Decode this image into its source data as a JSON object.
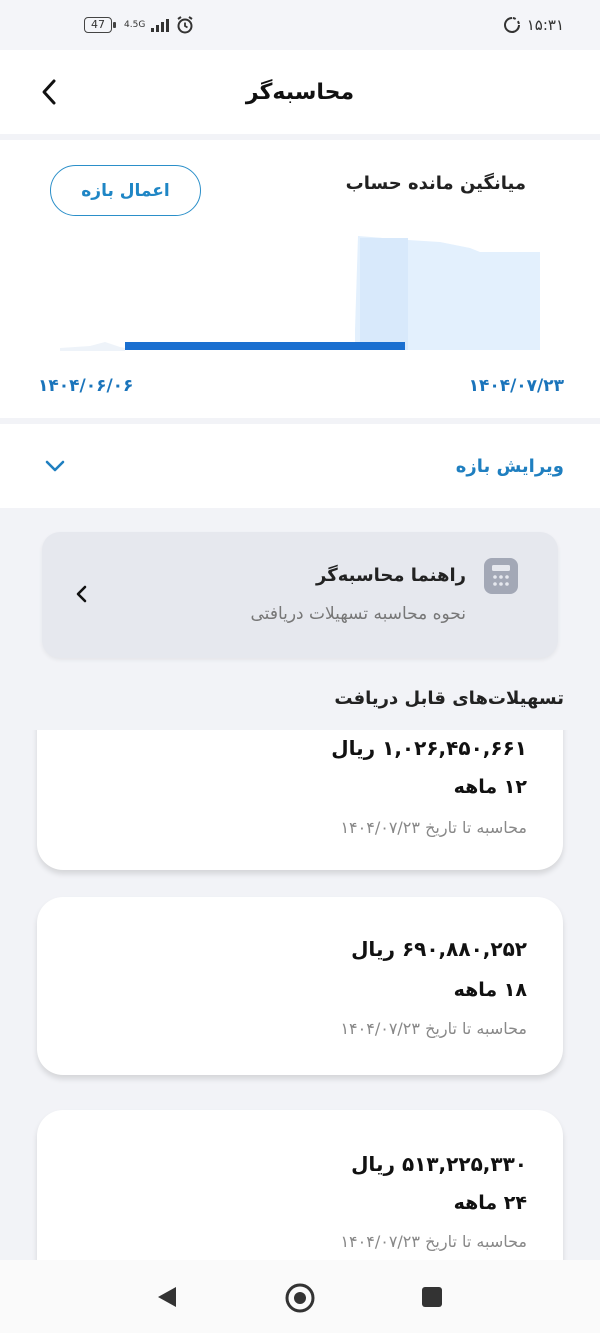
{
  "status_bar": {
    "battery": "47",
    "network": "4.5G",
    "time": "۱۵:۳۱"
  },
  "header": {
    "title": "محاسبه‌گر"
  },
  "chart_card": {
    "title": "میانگین مانده حساب",
    "apply_button": "اعمال بازه",
    "date_start": "۱۴۰۴/۰۶/۰۶",
    "date_end": "۱۴۰۴/۰۷/۲۳",
    "colors": {
      "selection_line": "#1a6fd0",
      "area_fill": "#e3f0fd"
    }
  },
  "edit_range": {
    "label": "ویرایش بازه"
  },
  "guide": {
    "title": "راهنما محاسبه‌گر",
    "subtitle": "نحوه محاسبه تسهیلات دریافتی"
  },
  "loans_section": {
    "title": "تسهیلات‌های قابل دریافت",
    "items": [
      {
        "amount": "۱,۰۲۶,۴۵۰,۶۶۱ ریال",
        "term": "۱۲ ماهه",
        "date_note": "محاسبه تا تاریخ ۱۴۰۴/۰۷/۲۳"
      },
      {
        "amount": "۶۹۰,۸۸۰,۲۵۲ ریال",
        "term": "۱۸ ماهه",
        "date_note": "محاسبه تا تاریخ ۱۴۰۴/۰۷/۲۳"
      },
      {
        "amount": "۵۱۳,۲۲۵,۳۳۰ ریال",
        "term": "۲۴ ماهه",
        "date_note": "محاسبه تا تاریخ ۱۴۰۴/۰۷/۲۳"
      }
    ]
  }
}
